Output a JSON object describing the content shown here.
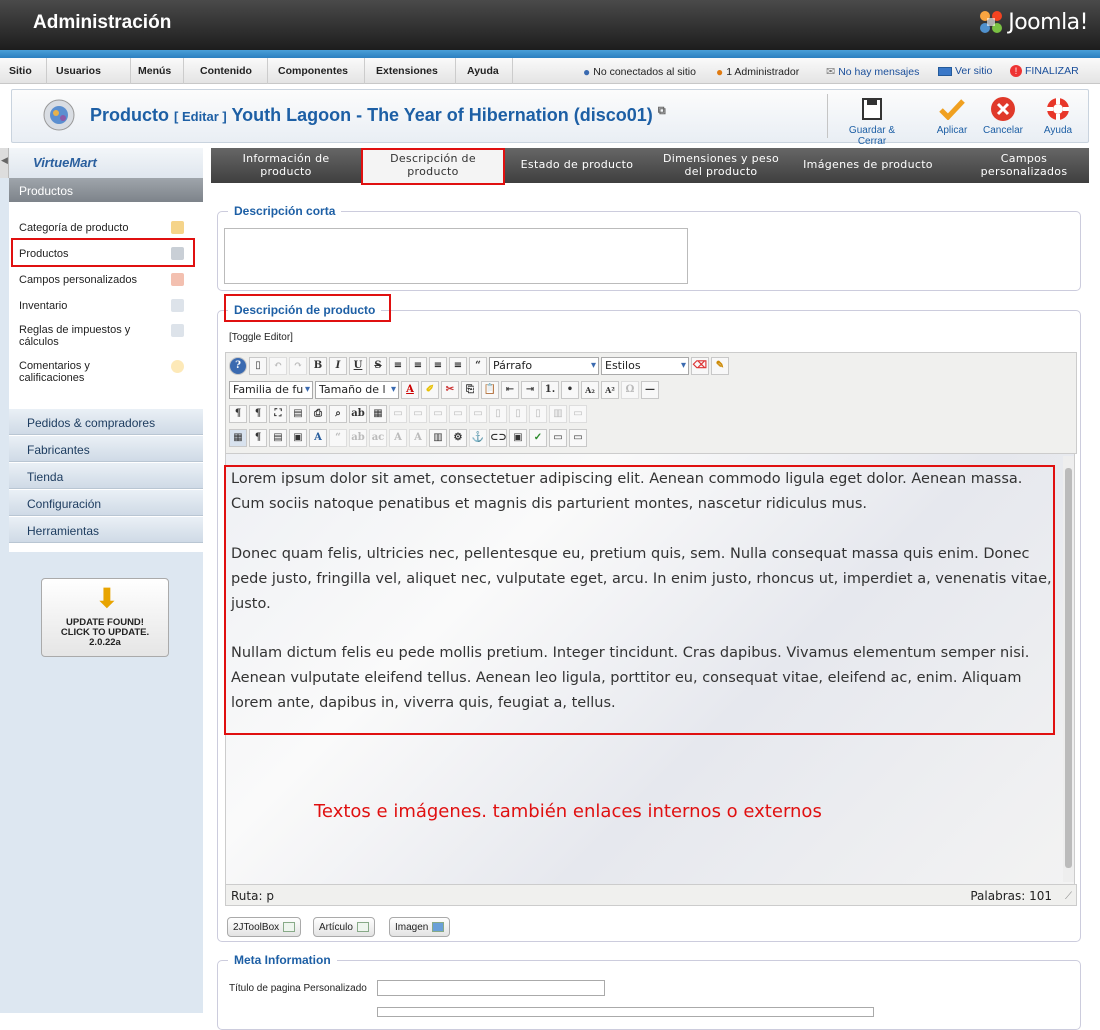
{
  "header": {
    "title": "Administración",
    "brand": "Joomla!"
  },
  "menu": {
    "items": [
      "Sitio",
      "Usuarios",
      "Menús",
      "Contenido",
      "Componentes",
      "Extensiones",
      "Ayuda"
    ],
    "status": {
      "visitors": "No conectados al sitio",
      "admins": "1 Administrador",
      "messages": "No hay mensajes",
      "view_site": "Ver sitio",
      "logout": "FINALIZAR"
    }
  },
  "toolbar": {
    "title": "Producto",
    "action": "[ Editar ]",
    "subject": "Youth Lagoon - The Year of Hibernation (disco01)",
    "buttons": {
      "save_close": "Guardar & Cerrar",
      "apply": "Aplicar",
      "cancel": "Cancelar",
      "help": "Ayuda"
    }
  },
  "sidebar": {
    "brand": "VirtueMart",
    "section": "Productos",
    "items": [
      "Categoría de producto",
      "Productos",
      "Campos personalizados",
      "Inventario",
      "Reglas de impuestos y cálculos",
      "Comentarios y calificaciones"
    ],
    "sections": [
      "Pedidos & compradores",
      "Fabricantes",
      "Tienda",
      "Configuración",
      "Herramientas"
    ],
    "update": {
      "line1": "UPDATE FOUND!",
      "line2": "CLICK TO UPDATE.",
      "version": "2.0.22a"
    }
  },
  "tabs": [
    {
      "l1": "Información de",
      "l2": "producto"
    },
    {
      "l1": "Descripción de",
      "l2": "producto"
    },
    {
      "l1": "Estado de producto",
      "l2": ""
    },
    {
      "l1": "Dimensiones y peso",
      "l2": "del producto"
    },
    {
      "l1": "Imágenes de producto",
      "l2": ""
    },
    {
      "l1": "Campos",
      "l2": "personalizados"
    }
  ],
  "short_desc": {
    "legend": "Descripción corta",
    "value": ""
  },
  "product_desc": {
    "legend": "Descripción de producto",
    "toggle": "[Toggle Editor]",
    "format_select": "Párrafo",
    "styles_select": "Estilos",
    "font_family_select": "Familia de fu",
    "font_size_select": "Tamaño de l",
    "paragraphs": [
      "Lorem ipsum dolor sit amet, consectetuer adipiscing elit. Aenean commodo ligula eget dolor. Aenean massa. Cum sociis natoque penatibus et magnis dis parturient montes, nascetur ridiculus mus.",
      "Donec quam felis, ultricies nec, pellentesque eu, pretium quis, sem. Nulla consequat massa quis enim. Donec pede justo, fringilla vel, aliquet nec, vulputate eget, arcu. In enim justo, rhoncus ut, imperdiet a, venenatis vitae, justo.",
      "Nullam dictum felis eu pede mollis pretium. Integer tincidunt. Cras dapibus. Vivamus elementum semper nisi. Aenean vulputate eleifend tellus. Aenean leo ligula, porttitor eu, consequat vitae, eleifend ac, enim. Aliquam lorem ante, dapibus in, viverra quis, feugiat a, tellus."
    ],
    "annotation": "Textos e imágenes. también enlaces internos o externos",
    "path": "Ruta: p",
    "words": "Palabras: 101",
    "extra_buttons": [
      "2JToolBox",
      "Artículo",
      "Imagen"
    ]
  },
  "meta": {
    "legend": "Meta Information",
    "custom_title_label": "Título de pagina Personalizado",
    "custom_title_value": ""
  },
  "colors": {
    "accent": "#1d5fa5",
    "highlight": "#e01010"
  }
}
